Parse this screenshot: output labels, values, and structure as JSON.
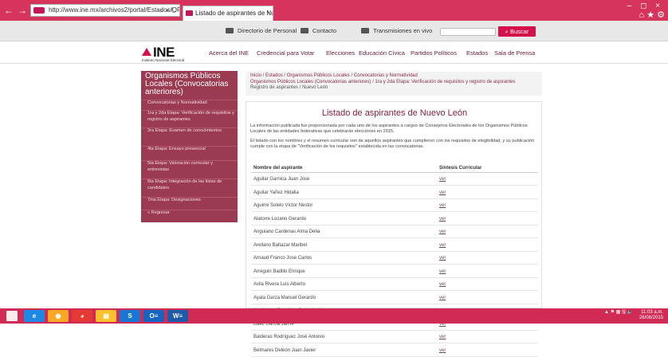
{
  "browser": {
    "url": "http://www.ine.mx/archivos2/portal/Estados/OPL/aspirantes/N",
    "tab_title": "Listado de aspirantes de Nu...",
    "window_controls": "– ◻ ×",
    "right_icons": "⌂ ★ ⚙"
  },
  "utility": {
    "directory": "Directorio de Personal",
    "contact": "Contacto",
    "live": "Transmisiones en vivo",
    "search_placeholder": "",
    "search_button": "Buscar"
  },
  "header": {
    "logo_text": "INE",
    "logo_sub": "Instituto Nacional Electoral",
    "nav": [
      "Acerca del INE",
      "Credencial para Votar",
      "Elecciones",
      "Educación Cívica",
      "Partidos Políticos",
      "Estados",
      "Sala de Prensa"
    ]
  },
  "sidebar": {
    "title": "Organismos Públicos Locales (Convocatorias anteriores)",
    "items": [
      "Convocatorias y Normatividad",
      "1ra y 2da Etapa: Verificación de requisitos y registro de aspirantes",
      "3ra Etapa: Examen de conocimientos",
      "4ta Etapa: Ensayo presencial",
      "5ta Etapa: Valoración curricular y entrevistas",
      "6ta Etapa: Integración de las listas de candidatos",
      "7ma Etapa: Designaciones"
    ],
    "back": "« Regresar"
  },
  "breadcrumb": {
    "items": [
      "Inicio",
      "Estados",
      "Organismos Públicos Locales",
      "Convocatorias y Normatividad",
      "Organismos Públicos Locales (Convocatorias anteriores)",
      "1ra y 2da Etapa: Verificación de requisitos y registro de aspirantes",
      "Registro de aspirantes",
      "Nuevo León"
    ]
  },
  "main": {
    "title": "Listado de aspirantes de Nuevo León",
    "para1": "La información publicada fue proporcionada por cada uno de los aspirantes a cargos de Consejeros Electorales de los Organismos Públicos Locales de las entidades federativas que celebrarán elecciones en 2015.",
    "para2": "El listado con los nombres y el resumen curricular son de aquellos aspirantes que cumplieron con los requisitos de elegibilidad, y su publicación cumple con la etapa de \"Verificación de los requisitos\" establecida en las convocatorias.",
    "col_name": "Nombre del aspirante",
    "col_summary": "Síntesis Curricular",
    "link_label": "ver",
    "rows": [
      "Aguilar Garnica Juan Jose",
      "Aguilar Yañez Hidalia",
      "Aguirre Solelo Víctor Nestor",
      "Alatorre Lozano Gerardo",
      "Anguiano Cardenas Alma Delia",
      "Arellano Baltazar Maribel",
      "Arnaud Franco Jose Carlos",
      "Arreguin Badillo Enrique",
      "Avila Rivera Luis Alberto",
      "Ayala Garza Manuel Gerardo",
      "Azpilcueta González Salvador Hugo",
      "Baez Garcia Jaime",
      "Balderas Rodríguez José Antonio",
      "Belmares Deleón Juan Javier"
    ]
  },
  "taskbar": {
    "apps": [
      "e",
      "◉",
      "◕",
      "▤",
      "S",
      "O≡",
      "W≡"
    ],
    "time": "11:03 a.m.",
    "date": "26/08/2015",
    "tray_icons": "▲ ⚑ ▦ 🖫 🔈"
  },
  "colors": {
    "brand": "#d5114b",
    "sidebar": "#9b3b52",
    "taskbar": "#d12a55",
    "title": "#8a1f3c"
  }
}
